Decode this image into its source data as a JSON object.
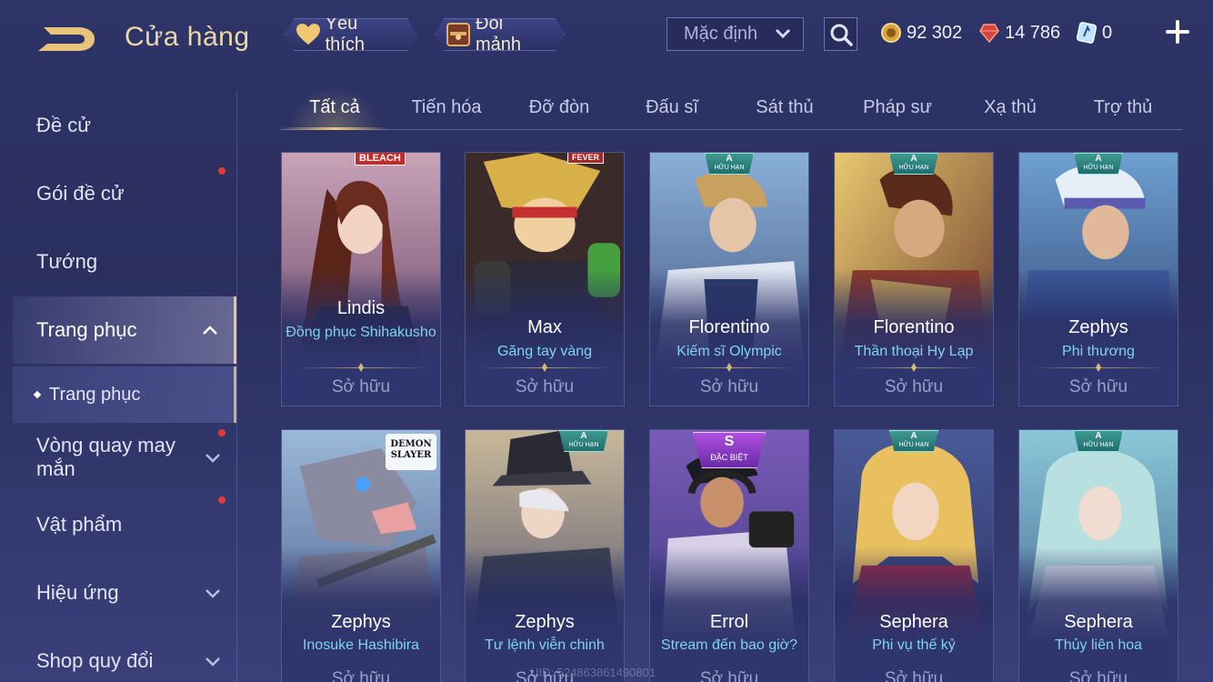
{
  "header": {
    "title": "Cửa hàng",
    "favorites_label": "Yêu thích",
    "fragments_label": "Đổi mảnh",
    "sort_value": "Mặc định",
    "currencies": [
      {
        "icon": "gold-coin-icon",
        "value": "92 302"
      },
      {
        "icon": "red-gem-icon",
        "value": "14 786"
      },
      {
        "icon": "voucher-icon",
        "value": "0"
      }
    ]
  },
  "sidebar": {
    "items": [
      {
        "label": "Đề cử"
      },
      {
        "label": "Gói đề cử"
      },
      {
        "label": "Tướng"
      },
      {
        "label": "Trang phục"
      },
      {
        "label": "Trang phục"
      },
      {
        "label": "Vòng quay may mắn"
      },
      {
        "label": "Vật phẩm"
      },
      {
        "label": "Hiệu ứng"
      },
      {
        "label": "Shop quy đổi"
      }
    ]
  },
  "tabs": [
    {
      "label": "Tất cả"
    },
    {
      "label": "Tiến hóa"
    },
    {
      "label": "Đỡ đòn"
    },
    {
      "label": "Đấu sĩ"
    },
    {
      "label": "Sát thủ"
    },
    {
      "label": "Pháp sư"
    },
    {
      "label": "Xạ thủ"
    },
    {
      "label": "Trợ thủ"
    }
  ],
  "cards": [
    {
      "hero": "Lindis",
      "skin": "Đồng phục Shihakusho",
      "status": "Sở hữu",
      "badge": "BLEACH",
      "badge_sub": ""
    },
    {
      "hero": "Max",
      "skin": "Găng tay vàng",
      "status": "Sở hữu",
      "badge": "FEVER",
      "badge_sub": ""
    },
    {
      "hero": "Florentino",
      "skin": "Kiếm sĩ Olympic",
      "status": "Sở hữu",
      "badge": "A",
      "badge_sub": "HỮU HẠN"
    },
    {
      "hero": "Florentino",
      "skin": "Thần thoại Hy Lạp",
      "status": "Sở hữu",
      "badge": "A",
      "badge_sub": "HỮU HẠN"
    },
    {
      "hero": "Zephys",
      "skin": "Phi thương",
      "status": "Sở hữu",
      "badge": "A",
      "badge_sub": "HỮU HẠN"
    },
    {
      "hero": "Zephys",
      "skin": "Inosuke Hashibira",
      "status": "Sở hữu",
      "badge": "DEMON SLAYER",
      "badge_sub": ""
    },
    {
      "hero": "Zephys",
      "skin": "Tư lệnh viễn chinh",
      "status": "Sở hữu",
      "badge": "A",
      "badge_sub": "HỮU HẠN"
    },
    {
      "hero": "Errol",
      "skin": "Stream đến bao giờ?",
      "status": "Sở hữu",
      "badge": "S",
      "badge_sub": "ĐẶC BIỆT"
    },
    {
      "hero": "Sephera",
      "skin": "Phi vụ thế kỷ",
      "status": "Sở hữu",
      "badge": "A",
      "badge_sub": "HỮU HẠN"
    },
    {
      "hero": "Sephera",
      "skin": "Thủy liên hoa",
      "status": "Sở hữu",
      "badge": "A",
      "badge_sub": "HỮU HẠN"
    }
  ],
  "footer": {
    "uid": "UID: 524863861490801"
  },
  "colors": {
    "accent_gold": "#e9c97e",
    "skin_name": "#7fd3f0",
    "notification_dot": "#e23a3a"
  }
}
